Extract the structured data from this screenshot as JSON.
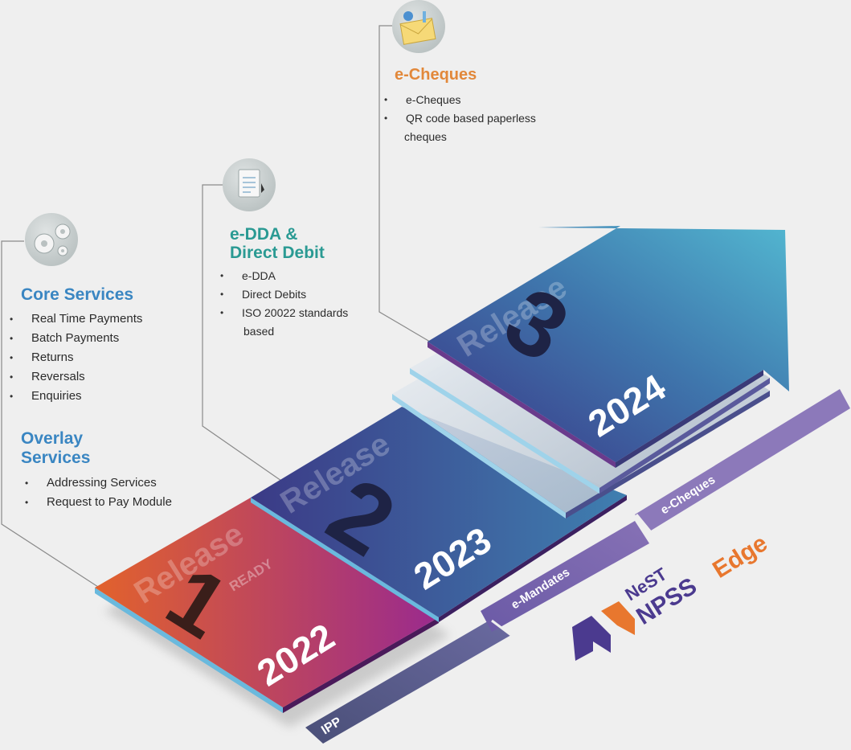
{
  "core": {
    "title": "Core Services",
    "items": [
      "Real Time Payments",
      "Batch Payments",
      "Returns",
      "Reversals",
      "Enquiries"
    ],
    "icon": "gears-icon"
  },
  "overlay": {
    "title_line1": "Overlay",
    "title_line2": "Services",
    "items": [
      "Addressing Services",
      "Request to Pay Module"
    ]
  },
  "edda": {
    "title_line1": "e-DDA &",
    "title_line2": "Direct Debit",
    "items": [
      "e-DDA",
      "Direct Debits",
      "ISO 20022 standards",
      "based"
    ],
    "icon": "document-icon"
  },
  "echeques": {
    "title": "e-Cheques",
    "items": [
      "e-Cheques",
      "QR code based  paperless",
      "cheques"
    ],
    "icon": "envelope-icon"
  },
  "releases": [
    {
      "word": "Release",
      "number": "1",
      "year": "2022",
      "status": "READY"
    },
    {
      "word": "Release",
      "number": "2",
      "year": "2023"
    },
    {
      "word": "Release",
      "number": "3",
      "year": "2024"
    }
  ],
  "tracks": [
    "IPP",
    "e-Mandates",
    "e-Cheques"
  ],
  "brand": {
    "line1": "NeST",
    "line2": "NPSS",
    "line3": "Edge",
    "purple": "#4b3a8f",
    "orange": "#e8772e"
  },
  "colors": {
    "release1_from": "#e2622c",
    "release1_to": "#9a2a8e",
    "release2_from": "#3b3a86",
    "release2_to": "#3f7fb0",
    "release3_from": "#3a3284",
    "release3_to": "#52b6d0"
  }
}
